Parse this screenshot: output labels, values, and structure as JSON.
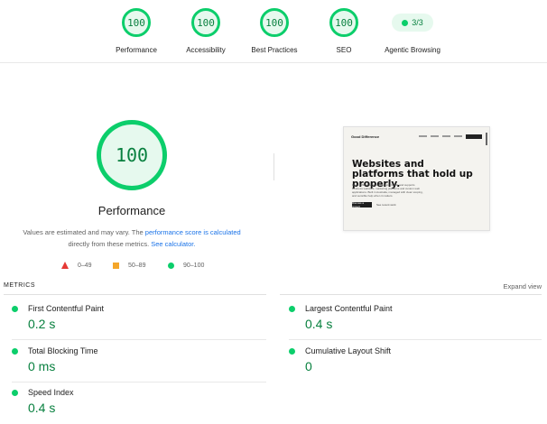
{
  "summary": {
    "gauges": [
      {
        "score": "100",
        "label": "Performance"
      },
      {
        "score": "100",
        "label": "Accessibility"
      },
      {
        "score": "100",
        "label": "Best Practices"
      },
      {
        "score": "100",
        "label": "SEO"
      }
    ],
    "agentic": {
      "value": "3/3",
      "label": "Agentic Browsing"
    }
  },
  "performance": {
    "score": "100",
    "title": "Performance",
    "desc_part1": "Values are estimated and may vary. The ",
    "desc_link1": "performance score is calculated",
    "desc_part2": " directly from these metrics. ",
    "desc_link2": "See calculator."
  },
  "legend": {
    "fail": "0–49",
    "average": "50–89",
    "pass": "90–100"
  },
  "screenshot": {
    "logo": "Good Difference",
    "heading": "Websites and platforms that hold up properly.",
    "body": "Good Difference plans, designs, builds and supports business websites, marketing platforms and custom web applications. Built in Australia, managed with clear scoping, and sensible help when it matters.",
    "button": "Discuss a project",
    "secondary": "See recent work"
  },
  "metrics": {
    "header": "METRICS",
    "expand": "Expand view",
    "items": [
      {
        "name": "First Contentful Paint",
        "value": "0.2 s"
      },
      {
        "name": "Largest Contentful Paint",
        "value": "0.4 s"
      },
      {
        "name": "Total Blocking Time",
        "value": "0 ms"
      },
      {
        "name": "Cumulative Layout Shift",
        "value": "0"
      },
      {
        "name": "Speed Index",
        "value": "0.4 s"
      }
    ]
  },
  "colors": {
    "pass": "#0cce6b",
    "pass_text": "#08803f",
    "average": "#f4a62a",
    "fail": "#e53935",
    "link": "#1a73e8"
  }
}
